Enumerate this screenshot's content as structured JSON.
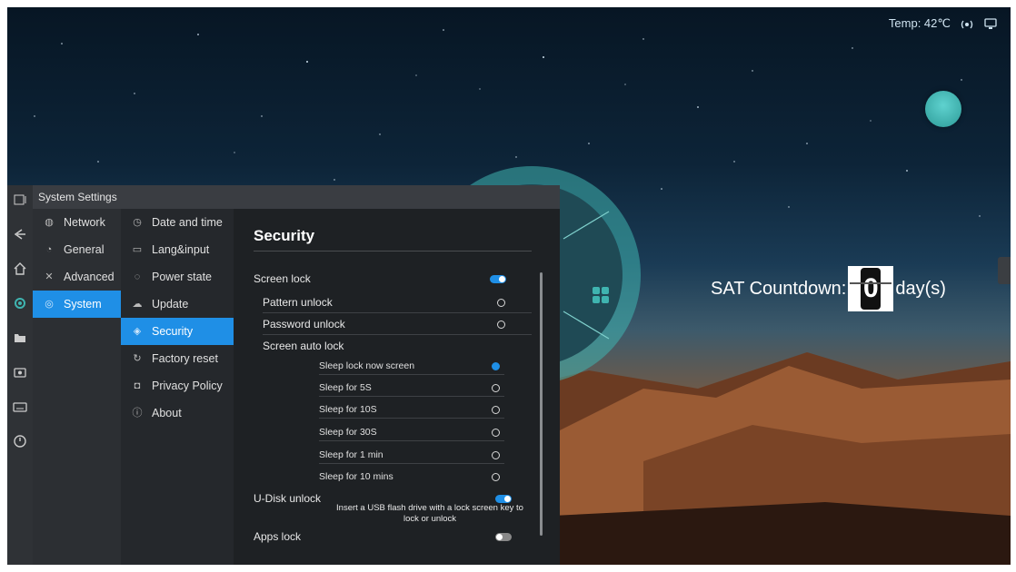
{
  "status_bar": {
    "temp": "Temp: 42℃",
    "icons": [
      "wireless-icon",
      "screen-icon"
    ]
  },
  "dock": {
    "icons": [
      "menu-icon",
      "back-icon",
      "home-icon",
      "settings-icon",
      "folder-icon",
      "camera-icon",
      "keyboard-icon",
      "power-icon"
    ]
  },
  "countdown": {
    "label": "SAT Countdown:",
    "value": "0",
    "unit": "day(s)"
  },
  "window": {
    "title": "System Settings"
  },
  "categories": [
    {
      "label": "Network",
      "icon": "globe-icon"
    },
    {
      "label": "General",
      "icon": "palette-icon"
    },
    {
      "label": "Advanced",
      "icon": "tools-icon"
    },
    {
      "label": "System",
      "icon": "gear-icon",
      "active": true
    }
  ],
  "subcategories": [
    {
      "label": "Date and time",
      "icon": "clock-icon"
    },
    {
      "label": "Lang&input",
      "icon": "keyboard-icon"
    },
    {
      "label": "Power state",
      "icon": "power-icon"
    },
    {
      "label": "Update",
      "icon": "cloud-icon"
    },
    {
      "label": "Security",
      "icon": "shield-icon",
      "active": true
    },
    {
      "label": "Factory reset",
      "icon": "reset-icon"
    },
    {
      "label": "Privacy Policy",
      "icon": "lock-icon"
    },
    {
      "label": "About",
      "icon": "info-icon"
    }
  ],
  "security": {
    "title": "Security",
    "screen_lock": {
      "label": "Screen lock",
      "enabled": true
    },
    "pattern_unlock": "Pattern unlock",
    "password_unlock": "Password unlock",
    "screen_auto_lock": "Screen auto lock",
    "auto_lock_options": [
      {
        "label": "Sleep lock now screen",
        "selected": true
      },
      {
        "label": "Sleep for 5S",
        "selected": false
      },
      {
        "label": "Sleep for 10S",
        "selected": false
      },
      {
        "label": "Sleep for 30S",
        "selected": false
      },
      {
        "label": "Sleep for 1 min",
        "selected": false
      },
      {
        "label": "Sleep for 10 mins",
        "selected": false
      }
    ],
    "udisk_unlock": {
      "label": "U-Disk unlock",
      "enabled": true,
      "note": "Insert a USB flash drive with a lock screen key to lock or unlock"
    },
    "apps_lock": {
      "label": "Apps lock",
      "enabled": false
    }
  },
  "colors": {
    "accent": "#1f8fe6",
    "teal": "#3fb4b0"
  }
}
